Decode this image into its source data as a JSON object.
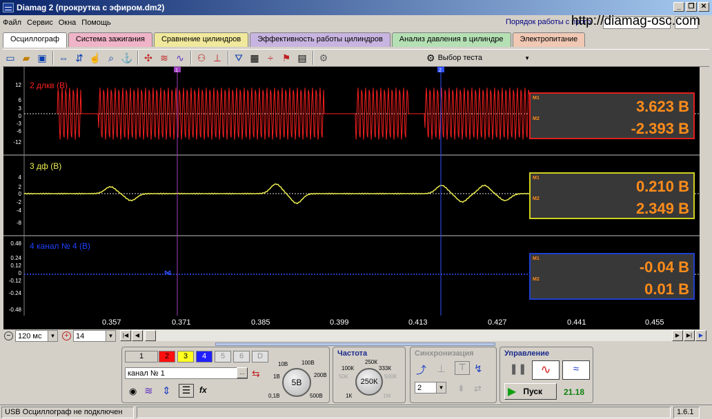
{
  "window": {
    "title": "Diamag 2 (прокрутка с эфиром.dm2)",
    "buttons": [
      "_",
      "❐",
      "✕"
    ]
  },
  "menu": {
    "items": [
      "Файл",
      "Сервис",
      "Окна",
      "Помощь"
    ],
    "help_link": "Порядок работы с прогр",
    "url": "http://diamag-osc.com"
  },
  "tabs": [
    {
      "label": "Осциллограф",
      "color": "#ffffff"
    },
    {
      "label": "Система зажигания",
      "color": "#f0b4c8"
    },
    {
      "label": "Сравнение цилиндров",
      "color": "#f0e89c"
    },
    {
      "label": "Эффективность работы цилиндров",
      "color": "#c8b4e0"
    },
    {
      "label": "Анализ давления в цилиндре",
      "color": "#b4e0b4"
    },
    {
      "label": "Электропитание",
      "color": "#f0c8b4"
    }
  ],
  "toolbar": {
    "test_select": "Выбор теста"
  },
  "channels": [
    {
      "name": "2 длкв (В)",
      "color": "#ff2020",
      "ticks": [
        "12",
        "6",
        "3",
        "0",
        "-3",
        "-6",
        "-12"
      ],
      "m1": "3.623 В",
      "m2": "-2.393 В"
    },
    {
      "name": "3 дф (В)",
      "color": "#f0f050",
      "ticks": [
        "4",
        "2",
        "0",
        "-2",
        "-4",
        "-8"
      ],
      "m1": "0.210 В",
      "m2": "2.349 В"
    },
    {
      "name": "4 канал № 4 (В)",
      "color": "#2040ff",
      "ticks": [
        "0.48",
        "0.24",
        "0.12",
        "0",
        "-0.12",
        "-0.24",
        "-0.48"
      ],
      "m1": "-0.04 В",
      "m2": "0.01 В"
    }
  ],
  "marker_labels": {
    "m1": "M1",
    "m2": "M2",
    "cursor1": "1",
    "cursor2": "2"
  },
  "x_ticks": [
    "0.357",
    "0.371",
    "0.385",
    "0.399",
    "0.413",
    "0.427",
    "0.441",
    "0.455"
  ],
  "timebase": {
    "value": "120 мс",
    "zoom": "14"
  },
  "channel_buttons": [
    "1",
    "2",
    "3",
    "4",
    "5",
    "6",
    "D"
  ],
  "channel_select": "канал № 1",
  "volt_knob": {
    "labels": [
      "10В",
      "100В",
      "1В",
      "200В",
      "0,1В",
      "500В"
    ],
    "value": "5В"
  },
  "frequency": {
    "title": "Частота",
    "labels": [
      "250К",
      "100К",
      "333К",
      "50К",
      "500К",
      "1К",
      "1М"
    ],
    "value": "250К"
  },
  "sync": {
    "title": "Синхронизация",
    "channel": "2"
  },
  "control": {
    "title": "Управление",
    "start": "Пуск",
    "fps": "21.18"
  },
  "status": {
    "text": "USB Осциллограф не подключен",
    "version": "1.6.1"
  }
}
